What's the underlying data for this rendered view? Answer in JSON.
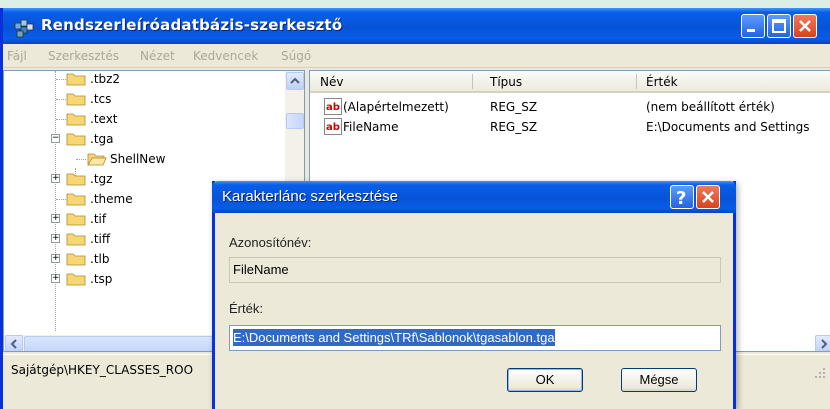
{
  "window": {
    "title": "Rendszerleíróadatbázis-szerkesztő"
  },
  "menu": [
    "Fájl",
    "Szerkesztés",
    "Nézet",
    "Kedvencek",
    "Súgó"
  ],
  "tree": {
    "items": [
      {
        "label": ".tbz2",
        "expander": ""
      },
      {
        "label": ".tcs",
        "expander": ""
      },
      {
        "label": ".text",
        "expander": ""
      },
      {
        "label": ".tga",
        "expander": "−"
      },
      {
        "label": "ShellNew",
        "expander": ""
      },
      {
        "label": ".tgz",
        "expander": "+"
      },
      {
        "label": ".theme",
        "expander": ""
      },
      {
        "label": ".tif",
        "expander": "+"
      },
      {
        "label": ".tiff",
        "expander": "+"
      },
      {
        "label": ".tlb",
        "expander": "+"
      },
      {
        "label": ".tsp",
        "expander": "+"
      }
    ]
  },
  "list": {
    "columns": [
      "Név",
      "Típus",
      "Érték"
    ],
    "rows": [
      {
        "name": "(Alapértelmezett)",
        "type": "REG_SZ",
        "value": "(nem beállított érték)"
      },
      {
        "name": "FileName",
        "type": "REG_SZ",
        "value": "E:\\Documents and Settings"
      }
    ]
  },
  "status": {
    "path": "Sajátgép\\HKEY_CLASSES_ROO"
  },
  "dialog": {
    "title": "Karakterlánc szerkesztése",
    "name_label": "Azonosítónév:",
    "name_value": "FileName",
    "value_label": "Érték:",
    "value_text": "E:\\Documents and Settings\\TRf\\Sablonok\\tgasablon.tga",
    "ok_label": "OK",
    "cancel_label": "Mégse"
  },
  "icons": {
    "app": "regedit-icon",
    "folder": "folder-icon",
    "string_value": "ab-string-icon"
  }
}
